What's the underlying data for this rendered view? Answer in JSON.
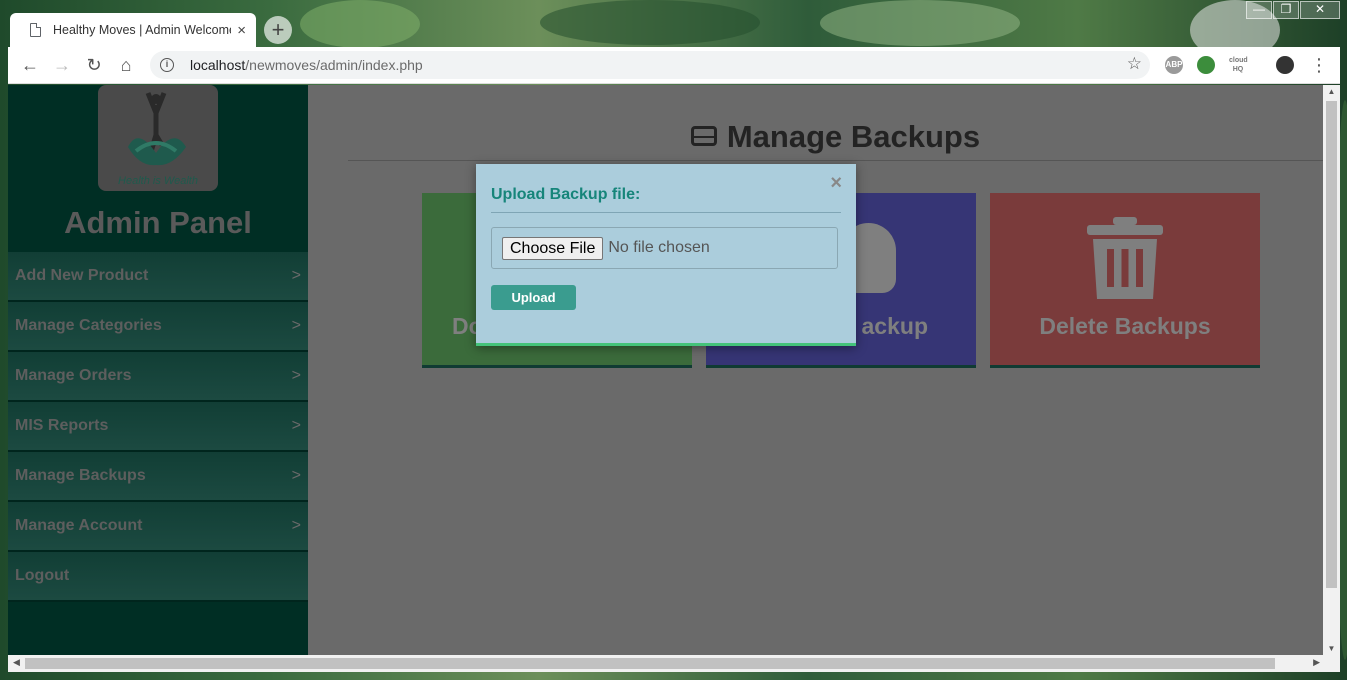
{
  "browser": {
    "tab_title": "Healthy Moves | Admin Welcome",
    "tab_close": "×",
    "new_tab": "+",
    "url_host": "localhost",
    "url_path": "/newmoves/admin/index.php",
    "window_controls": {
      "minimize": "—",
      "maximize": "❐",
      "close": "✕"
    },
    "extensions": [
      "ABP",
      "cloud HQ"
    ]
  },
  "sidebar": {
    "logo_text": "Health is Wealth",
    "title": "Admin Panel",
    "items": [
      {
        "label": "Add New Product",
        "chevron": ">"
      },
      {
        "label": "Manage Categories",
        "chevron": ">"
      },
      {
        "label": "Manage Orders",
        "chevron": ">"
      },
      {
        "label": "MIS Reports",
        "chevron": ">"
      },
      {
        "label": "Manage Backups",
        "chevron": ">"
      },
      {
        "label": "Manage Account",
        "chevron": ">"
      },
      {
        "label": "Logout",
        "chevron": ""
      }
    ]
  },
  "main": {
    "heading": "Manage Backups",
    "cards": [
      {
        "label": "Do"
      },
      {
        "label": "ackup"
      },
      {
        "label": "Delete Backups"
      }
    ]
  },
  "modal": {
    "close": "×",
    "title": "Upload Backup file:",
    "choose_file": "Choose File",
    "no_file": "No file chosen",
    "upload": "Upload"
  },
  "colors": {
    "sidebar_bg": "#002e24",
    "modal_bg": "#abcddc",
    "accent": "#16857a",
    "upload_button": "#3a9c8f"
  }
}
